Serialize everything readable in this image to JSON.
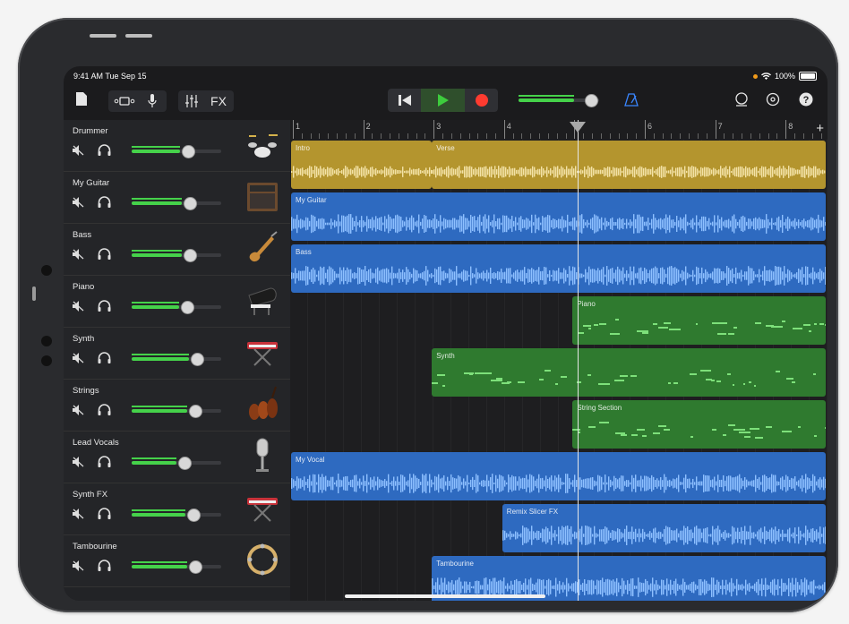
{
  "status": {
    "time": "9:41 AM  Tue Sep 15",
    "battery": "100%"
  },
  "toolbar": {
    "fx_label": "FX"
  },
  "ruler": {
    "marks": [
      "1",
      "2",
      "3",
      "4",
      "5",
      "6",
      "7",
      "8"
    ]
  },
  "tracks": [
    {
      "name": "Drummer",
      "volume": 0.62,
      "instrument": "drum-kit",
      "color": "#b4952e"
    },
    {
      "name": "My Guitar",
      "volume": 0.64,
      "instrument": "amplifier",
      "color": "#2e6ac0"
    },
    {
      "name": "Bass",
      "volume": 0.64,
      "instrument": "bass-guitar",
      "color": "#2e6ac0"
    },
    {
      "name": "Piano",
      "volume": 0.61,
      "instrument": "grand-piano",
      "color": "#2f7a2f"
    },
    {
      "name": "Synth",
      "volume": 0.72,
      "instrument": "keyboard",
      "color": "#2f7a2f"
    },
    {
      "name": "Strings",
      "volume": 0.7,
      "instrument": "violins",
      "color": "#2f7a2f"
    },
    {
      "name": "Lead Vocals",
      "volume": 0.58,
      "instrument": "microphone",
      "color": "#2e6ac0"
    },
    {
      "name": "Synth FX",
      "volume": 0.68,
      "instrument": "keyboard",
      "color": "#2e6ac0"
    },
    {
      "name": "Tambourine",
      "volume": 0.7,
      "instrument": "tambourine",
      "color": "#2e6ac0"
    }
  ],
  "regions": [
    {
      "track": 0,
      "label": "Intro",
      "start": 1,
      "end": 3
    },
    {
      "track": 0,
      "label": "Verse",
      "start": 3,
      "end": 8.6
    },
    {
      "track": 1,
      "label": "My Guitar",
      "start": 1,
      "end": 8.6
    },
    {
      "track": 2,
      "label": "Bass",
      "start": 1,
      "end": 8.6
    },
    {
      "track": 3,
      "label": "Piano",
      "start": 5,
      "end": 8.6
    },
    {
      "track": 4,
      "label": "Synth",
      "start": 3,
      "end": 8.6
    },
    {
      "track": 5,
      "label": "String Section",
      "start": 5,
      "end": 8.6
    },
    {
      "track": 6,
      "label": "My Vocal",
      "start": 1,
      "end": 8.6
    },
    {
      "track": 7,
      "label": "Remix Slicer FX",
      "start": 4,
      "end": 8.6
    },
    {
      "track": 8,
      "label": "Tambourine",
      "start": 3,
      "end": 8.6
    }
  ],
  "playhead_bar": 5.05
}
